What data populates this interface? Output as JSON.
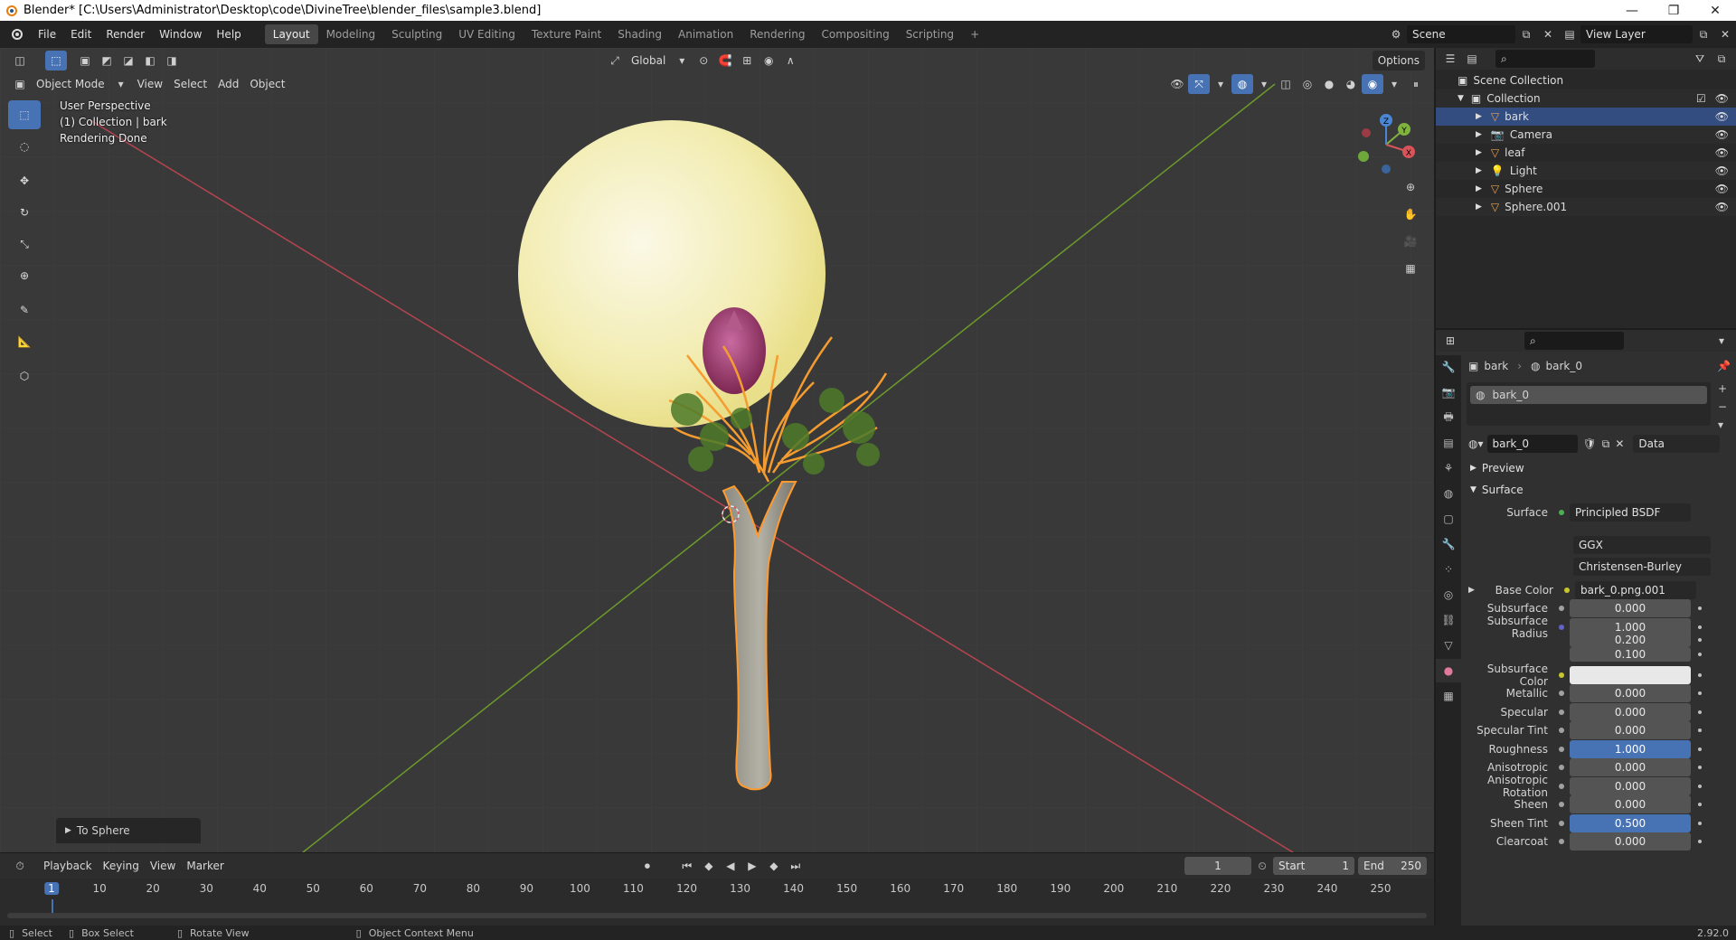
{
  "window": {
    "title": "Blender* [C:\\Users\\Administrator\\Desktop\\code\\DivineTree\\blender_files\\sample3.blend]"
  },
  "menu": [
    "File",
    "Edit",
    "Render",
    "Window",
    "Help"
  ],
  "workspaces": [
    "Layout",
    "Modeling",
    "Sculpting",
    "UV Editing",
    "Texture Paint",
    "Shading",
    "Animation",
    "Rendering",
    "Compositing",
    "Scripting"
  ],
  "active_workspace": "Layout",
  "scene": {
    "scene_name": "Scene",
    "view_layer": "View Layer"
  },
  "viewport": {
    "mode": "Object Mode",
    "header_menus": [
      "View",
      "Select",
      "Add",
      "Object"
    ],
    "orientation": "Global",
    "options_label": "Options",
    "info": [
      "User Perspective",
      "(1) Collection | bark",
      "Rendering Done"
    ],
    "last_operator": "To Sphere",
    "gizmo": {
      "x": "X",
      "y": "Y",
      "z": "Z"
    }
  },
  "timeline": {
    "menus": [
      "Playback",
      "Keying",
      "View",
      "Marker"
    ],
    "current_frame": "1",
    "start_label": "Start",
    "start": "1",
    "end_label": "End",
    "end": "250",
    "ticks": [
      "1",
      "10",
      "20",
      "30",
      "40",
      "50",
      "60",
      "70",
      "80",
      "90",
      "100",
      "110",
      "120",
      "130",
      "140",
      "150",
      "160",
      "170",
      "180",
      "190",
      "200",
      "210",
      "220",
      "230",
      "240",
      "250"
    ]
  },
  "statusbar": {
    "select": "Select",
    "box_select": "Box Select",
    "rotate": "Rotate View",
    "context": "Object Context Menu",
    "version": "2.92.0"
  },
  "outliner": {
    "root": "Scene Collection",
    "collection": "Collection",
    "items": [
      {
        "name": "bark",
        "selected": true
      },
      {
        "name": "Camera",
        "selected": false
      },
      {
        "name": "leaf",
        "selected": false
      },
      {
        "name": "Light",
        "selected": false
      },
      {
        "name": "Sphere",
        "selected": false
      },
      {
        "name": "Sphere.001",
        "selected": false
      }
    ]
  },
  "properties": {
    "breadcrumb_object": "bark",
    "breadcrumb_material": "bark_0",
    "slot": "bark_0",
    "material_name": "bark_0",
    "link": "Data",
    "preview_label": "Preview",
    "surface_panel": "Surface",
    "surface_label": "Surface",
    "surface_shader": "Principled BSDF",
    "distribution": "GGX",
    "subsurface_method": "Christensen-Burley",
    "base_color_label": "Base Color",
    "base_color_value": "bark_0.png.001",
    "fields": [
      {
        "label": "Subsurface",
        "value": "0.000"
      },
      {
        "label": "Subsurface Radius",
        "value": "1.000"
      },
      {
        "label": "",
        "value": "0.200"
      },
      {
        "label": "",
        "value": "0.100"
      },
      {
        "label": "Subsurface Color",
        "value": ""
      },
      {
        "label": "Metallic",
        "value": "0.000"
      },
      {
        "label": "Specular",
        "value": "0.000"
      },
      {
        "label": "Specular Tint",
        "value": "0.000"
      },
      {
        "label": "Roughness",
        "value": "1.000"
      },
      {
        "label": "Anisotropic",
        "value": "0.000"
      },
      {
        "label": "Anisotropic Rotation",
        "value": "0.000"
      },
      {
        "label": "Sheen",
        "value": "0.000"
      },
      {
        "label": "Sheen Tint",
        "value": "0.500"
      },
      {
        "label": "Clearcoat",
        "value": "0.000"
      }
    ]
  },
  "colors": {
    "accent": "#4772b3",
    "x_axis": "#d9545a",
    "y_axis": "#7fb33d",
    "selection": "#f5a623"
  }
}
